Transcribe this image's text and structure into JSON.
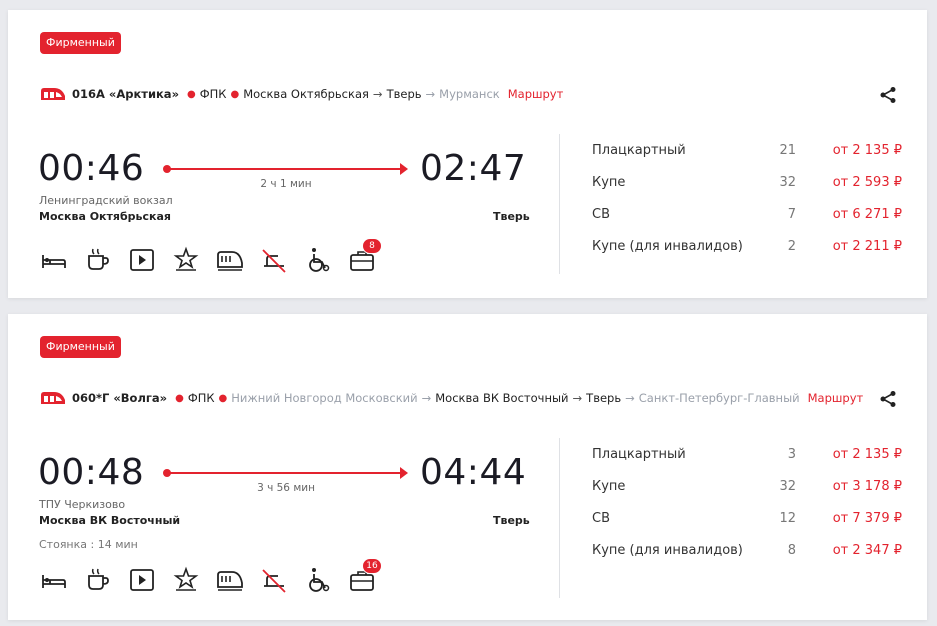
{
  "colors": {
    "accent": "#e3232e",
    "text": "#222222",
    "muted": "#9aa0aa"
  },
  "trains": [
    {
      "badge": "Фирменный",
      "number": "016А «Арктика»",
      "carrier": "ФПК",
      "route_from": "Москва Октябрьская",
      "route_to": "Тверь",
      "route_final": "Мурманск",
      "route_link": "Маршрут",
      "depart_time": "00:46",
      "arrive_time": "02:47",
      "duration": "2 ч 1 мин",
      "depart_sub": "Ленинградский вокзал",
      "depart_station": "Москва Октябрьская",
      "arrive_station": "Тверь",
      "services_badge": "8",
      "classes": [
        {
          "name": "Плацкартный",
          "seats": "21",
          "price": "от 2 135 ₽"
        },
        {
          "name": "Купе",
          "seats": "32",
          "price": "от 2 593 ₽"
        },
        {
          "name": "СВ",
          "seats": "7",
          "price": "от 6 271 ₽"
        },
        {
          "name": "Купе (для инвалидов)",
          "seats": "2",
          "price": "от 2 211 ₽"
        }
      ]
    },
    {
      "badge": "Фирменный",
      "number": "060*Г «Волга»",
      "carrier": "ФПК",
      "route_origin": "Нижний Новгород Московский",
      "route_from": "Москва ВК Восточный",
      "route_to": "Тверь",
      "route_final": "Санкт-Петербург-Главный",
      "route_link": "Маршрут",
      "depart_time": "00:48",
      "arrive_time": "04:44",
      "duration": "3 ч 56 мин",
      "depart_sub": "ТПУ Черкизово",
      "depart_station": "Москва ВК Восточный",
      "arrive_station": "Тверь",
      "stop": "Стоянка : 14 мин",
      "services_badge": "16",
      "classes": [
        {
          "name": "Плацкартный",
          "seats": "3",
          "price": "от 2 135 ₽"
        },
        {
          "name": "Купе",
          "seats": "32",
          "price": "от 3 178 ₽"
        },
        {
          "name": "СВ",
          "seats": "12",
          "price": "от 7 379 ₽"
        },
        {
          "name": "Купе (для инвалидов)",
          "seats": "8",
          "price": "от 2 347 ₽"
        }
      ]
    }
  ]
}
